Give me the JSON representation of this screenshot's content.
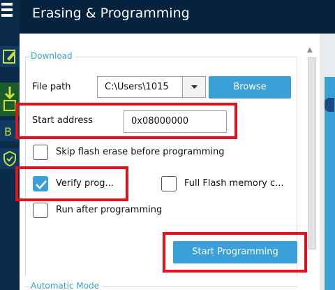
{
  "header": {
    "title": "Erasing & Programming"
  },
  "download": {
    "group_label": "Download",
    "file_path_label": "File path",
    "file_path_value": "C:\\Users\\1015",
    "browse_label": "Browse",
    "start_address_label": "Start address",
    "start_address_value": "0x08000000",
    "skip_flash_erase_label": "Skip flash erase before programming",
    "skip_flash_erase_checked": false,
    "verify_label": "Verify prog...",
    "verify_checked": true,
    "full_flash_label": "Full Flash memory c...",
    "full_flash_checked": false,
    "run_after_label": "Run after programming",
    "run_after_checked": false,
    "start_programming_label": "Start Programming"
  },
  "automatic_mode": {
    "group_label": "Automatic Mode"
  },
  "colors": {
    "header_bg": "#05223e",
    "accent": "#3aa0d8",
    "highlight_box": "#e0141e"
  },
  "icons": [
    "menu-icon",
    "edit-icon",
    "download-icon",
    "ob-icon",
    "security-icon",
    "chevron-down-icon",
    "check-icon",
    "scroll-up-icon"
  ]
}
